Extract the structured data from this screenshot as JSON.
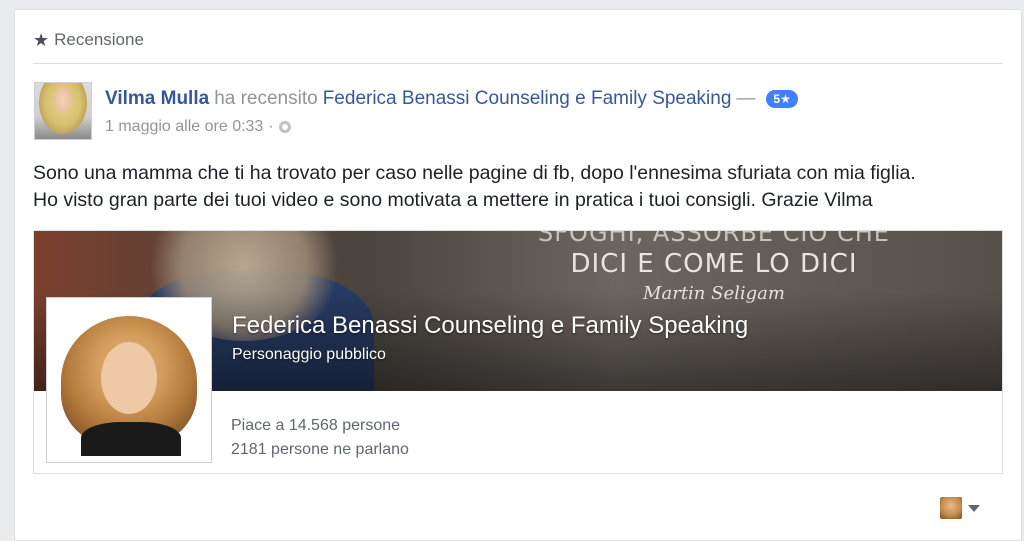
{
  "header": {
    "icon": "star-icon",
    "label": "Recensione"
  },
  "post": {
    "author_name": "Vilma Mulla",
    "action_text": "ha recensito",
    "page_name": "Federica Benassi Counseling e Family Speaking",
    "dash": "—",
    "rating_label": "5★",
    "timestamp": "1 maggio alle ore 0:33",
    "dot": "·",
    "audience_icon": "globe-icon",
    "text_line1": "Sono una mamma che ti ha trovato per caso nelle pagine di fb, dopo l'ennesima sfuriata con mia figlia.",
    "text_line2": "Ho visto gran parte dei tuoi video e sono motivata a mettere in pratica i tuoi consigli. Grazie Vilma"
  },
  "page_card": {
    "cover_quote_line1": "SFOGHI, ASSORBE CIÒ CHE",
    "cover_quote_line2": "DICI E COME LO DICI",
    "cover_quote_author": "Martin Seligam",
    "title": "Federica Benassi Counseling e Family Speaking",
    "subtitle": "Personaggio pubblico",
    "likes": "Piace a 14.568 persone",
    "talking": "2181 persone ne parlano"
  },
  "footer": {
    "viewer_icon": "viewer-avatar",
    "menu_icon": "chevron-down-icon"
  }
}
